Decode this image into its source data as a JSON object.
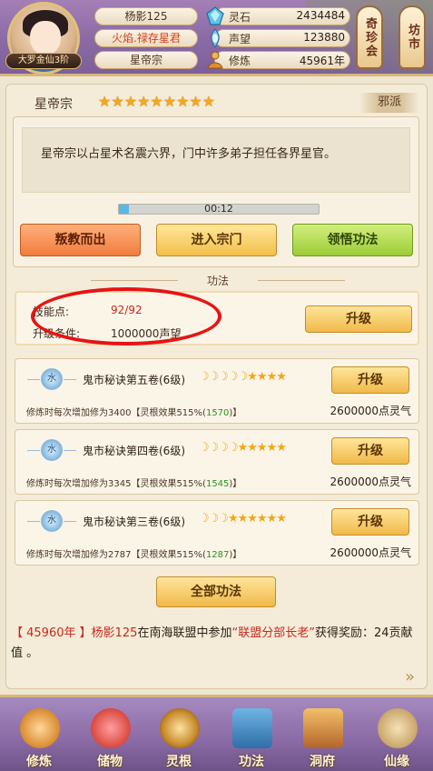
{
  "header": {
    "rank_badge": "大罗金仙3阶",
    "player_name": "杨影125",
    "title": "火焰.禄存星君",
    "sect": "星帝宗",
    "resources": [
      {
        "label": "灵石",
        "value": "2434484",
        "icon": "spirit-stone-icon"
      },
      {
        "label": "声望",
        "value": "123880",
        "icon": "reputation-icon"
      },
      {
        "label": "修炼",
        "value": "45961年",
        "icon": "cultivation-icon"
      }
    ],
    "side_buttons": [
      "奇珍会",
      "坊市"
    ]
  },
  "sect_info": {
    "name": "星帝宗",
    "stars": "★★★★★★★★★",
    "faction": "邪派",
    "description": "星帝宗以占星术名震六界，门中许多弟子担任各界星官。",
    "timer": "00:12",
    "progress": 0.05,
    "buttons": {
      "betray": "叛教而出",
      "enter": "进入宗门",
      "comprehend": "领悟功法"
    }
  },
  "skills_section": {
    "title": "功法",
    "skill_points_label": "技能点:",
    "skill_points_value": "92/92",
    "condition_label": "升级条件:",
    "condition_value": "1000000声望",
    "upgrade_label": "升级",
    "items": [
      {
        "element": "水",
        "name": "鬼市秘诀第五卷(6级)",
        "moons": "☽☽☽☽☽★★★★",
        "upgrade_label": "升级",
        "desc_prefix": "修炼时每次增加修为3400【灵根效果515%(",
        "desc_green": "1570",
        "desc_suffix": ")】",
        "cost": "2600000点灵气"
      },
      {
        "element": "水",
        "name": "鬼市秘诀第四卷(6级)",
        "moons": "☽☽☽☽★★★★★",
        "upgrade_label": "升级",
        "desc_prefix": "修炼时每次增加修为3345【灵根效果515%(",
        "desc_green": "1545",
        "desc_suffix": ")】",
        "cost": "2600000点灵气"
      },
      {
        "element": "水",
        "name": "鬼市秘诀第三卷(6级)",
        "moons": "☽☽☽★★★★★★",
        "upgrade_label": "升级",
        "desc_prefix": "修炼时每次增加修为2787【灵根效果515%(",
        "desc_green": "1287",
        "desc_suffix": ")】",
        "cost": "2600000点灵气"
      }
    ],
    "all_skills_label": "全部功法"
  },
  "news": {
    "year": "【 45960年 】",
    "player": "杨影125",
    "mid": "在南海联盟中参加",
    "event": "“联盟分部长老”",
    "reward": "获得奖励：24贡献值 。"
  },
  "bottom_nav": [
    {
      "label": "修炼",
      "icon": "cultivate-icon"
    },
    {
      "label": "储物",
      "icon": "storage-bag-icon"
    },
    {
      "label": "灵根",
      "icon": "spirit-root-icon"
    },
    {
      "label": "功法",
      "icon": "skill-book-icon"
    },
    {
      "label": "洞府",
      "icon": "cave-mansion-icon"
    },
    {
      "label": "仙缘",
      "icon": "fate-icon"
    }
  ]
}
